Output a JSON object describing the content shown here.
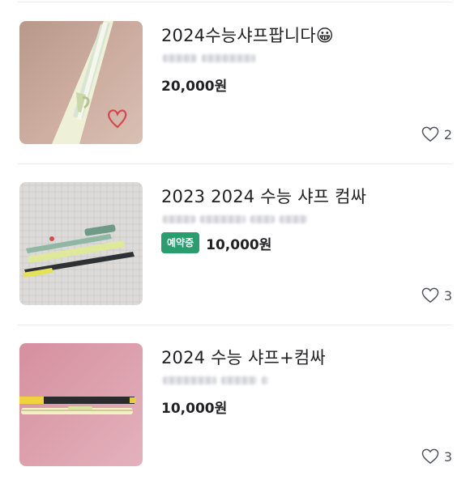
{
  "items": [
    {
      "title": "2024수능샤프팝니다😀",
      "price": "20,000원",
      "badge": "",
      "likes": "2",
      "thumb_icon": "pen-photo-beige",
      "thumb_color": "#c9a99a"
    },
    {
      "title": "2023 2024 수능 샤프 컴싸",
      "price": "10,000원",
      "badge": "예약중",
      "likes": "3",
      "thumb_icon": "pens-photo-white-blanket",
      "thumb_color": "#dcdad8"
    },
    {
      "title": "2024 수능 샤프+컴싸",
      "price": "10,000원",
      "badge": "",
      "likes": "3",
      "thumb_icon": "pens-photo-pink-background",
      "thumb_color": "#d9a2ae"
    }
  ],
  "colors": {
    "badge_green": "#2a9d6e",
    "text_primary": "#212124",
    "text_secondary": "#4d5159",
    "divider": "#eaebee"
  }
}
